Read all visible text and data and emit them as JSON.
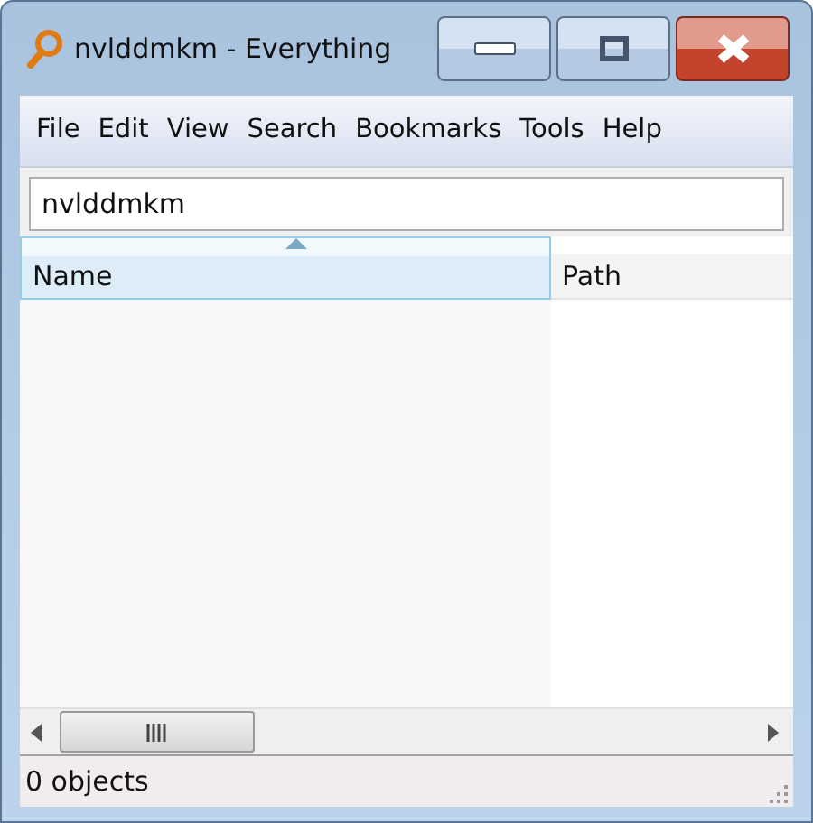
{
  "window": {
    "title": "nvlddmkm - Everything"
  },
  "menu": [
    "File",
    "Edit",
    "View",
    "Search",
    "Bookmarks",
    "Tools",
    "Help"
  ],
  "search": {
    "value": "nvlddmkm"
  },
  "columns": [
    {
      "label": "Name",
      "selected": true
    },
    {
      "label": "Path",
      "selected": false
    }
  ],
  "status_bar": "0 objects"
}
